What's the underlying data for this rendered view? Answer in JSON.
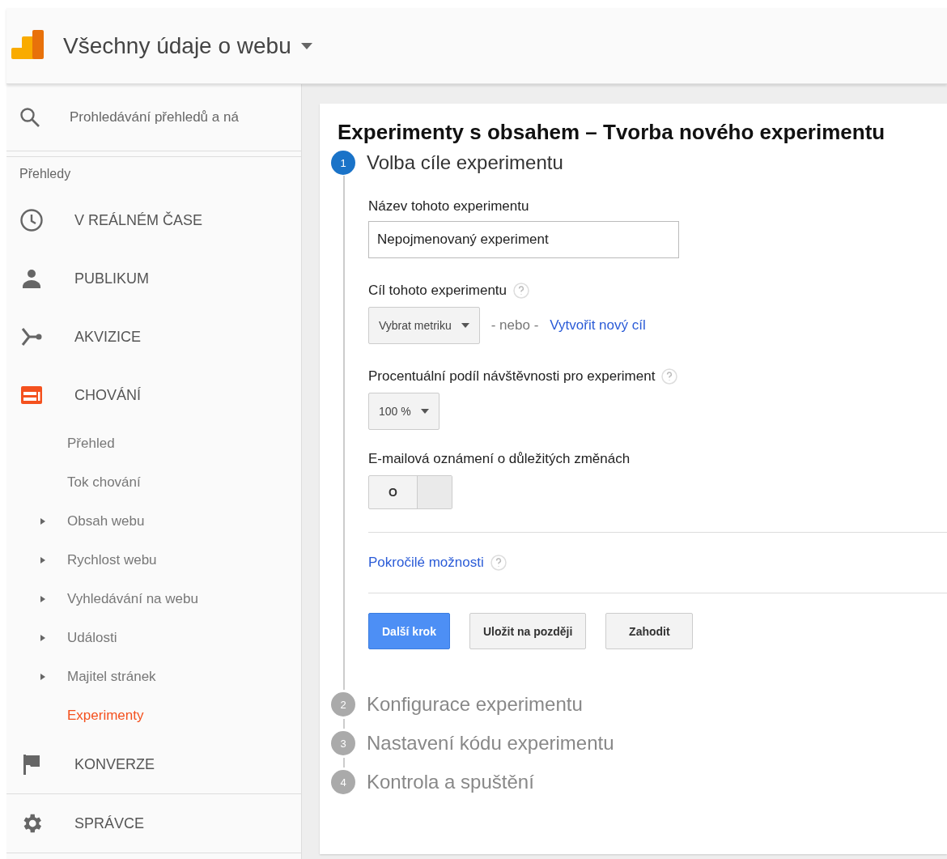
{
  "header": {
    "title": "Všechny údaje o webu"
  },
  "sidebar": {
    "search": {
      "placeholder": "Prohledávání přehledů a ná"
    },
    "heading": "Přehledy",
    "items": [
      {
        "kind": "section",
        "label": "V REÁLNÉM ČASE",
        "active": false
      },
      {
        "kind": "section",
        "label": "PUBLIKUM",
        "active": false
      },
      {
        "kind": "section",
        "label": "AKVIZICE",
        "active": false
      },
      {
        "kind": "section",
        "label": "CHOVÁNÍ",
        "active": true,
        "children": [
          {
            "kind": "leaf",
            "label": "Přehled",
            "selected": false
          },
          {
            "kind": "leaf",
            "label": "Tok chování",
            "selected": false
          },
          {
            "kind": "group",
            "label": "Obsah webu",
            "selected": false
          },
          {
            "kind": "group",
            "label": "Rychlost webu",
            "selected": false
          },
          {
            "kind": "group",
            "label": "Vyhledávání na webu",
            "selected": false
          },
          {
            "kind": "group",
            "label": "Události",
            "selected": false
          },
          {
            "kind": "group",
            "label": "Majitel stránek",
            "selected": false
          },
          {
            "kind": "leaf",
            "label": "Experimenty",
            "selected": true
          }
        ]
      },
      {
        "kind": "section",
        "label": "KONVERZE",
        "active": false
      }
    ],
    "admin": {
      "label": "SPRÁVCE"
    }
  },
  "main": {
    "title": "Experimenty s obsahem – Tvorba nového experimentu",
    "steps": [
      {
        "number": "1",
        "label": "Volba cíle experimentu",
        "active": true
      },
      {
        "number": "2",
        "label": "Konfigurace experimentu",
        "active": false
      },
      {
        "number": "3",
        "label": "Nastavení kódu experimentu",
        "active": false
      },
      {
        "number": "4",
        "label": "Kontrola a spuštění",
        "active": false
      }
    ],
    "form": {
      "name_label": "Název tohoto experimentu",
      "name_value": "Nepojmenovaný experiment",
      "goal_label": "Cíl tohoto experimentu",
      "goal_select": "Vybrat metriku",
      "goal_or": "- nebo -",
      "goal_link": "Vytvořit nový cíl",
      "traffic_label": "Procentuální podíl návštěvnosti pro experiment",
      "traffic_select": "100 %",
      "email_label": "E-mailová oznámení o důležitých změnách",
      "email_toggle": {
        "text": "O",
        "on": false
      },
      "advanced_link": "Pokročilé možnosti",
      "buttons": [
        {
          "label": "Další krok",
          "kind": "primary"
        },
        {
          "label": "Uložit na později",
          "kind": "secondary"
        },
        {
          "label": "Zahodit",
          "kind": "secondary"
        }
      ]
    }
  }
}
